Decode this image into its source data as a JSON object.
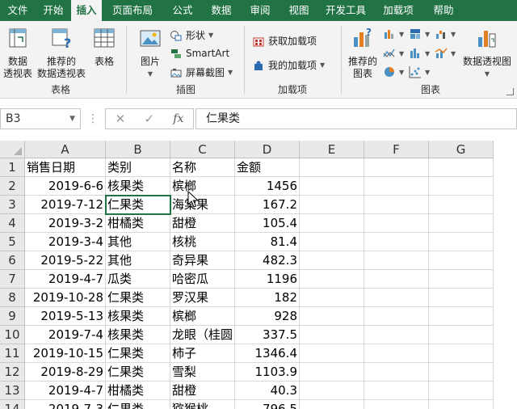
{
  "ribbon_tabs": [
    "文件",
    "开始",
    "插入",
    "页面布局",
    "公式",
    "数据",
    "审阅",
    "视图",
    "开发工具",
    "加载项",
    "帮助"
  ],
  "active_tab": "插入",
  "ribbon": {
    "tables": {
      "label": "表格",
      "pivot": "数据\n透视表",
      "recommended_pivot": "推荐的\n数据透视表",
      "table": "表格"
    },
    "illustrations": {
      "label": "插图",
      "pictures": "图片",
      "shapes": "形状",
      "smartart": "SmartArt",
      "screenshot": "屏幕截图"
    },
    "addins": {
      "label": "加载项",
      "get_addins": "获取加载项",
      "my_addins": "我的加载项"
    },
    "charts": {
      "label": "图表",
      "recommended_charts": "推荐的\n图表",
      "pivot_chart": "数据透视图"
    }
  },
  "formula_bar": {
    "name_box": "B3",
    "fx": "fx",
    "value": "仁果类"
  },
  "columns": [
    "A",
    "B",
    "C",
    "D",
    "E",
    "F",
    "G"
  ],
  "rows": [
    {
      "n": "1",
      "a": "销售日期",
      "b": "类别",
      "c": "名称",
      "d": "金额"
    },
    {
      "n": "2",
      "a": "2019-6-6",
      "b": "核果类",
      "c": "槟榔",
      "d": "1456"
    },
    {
      "n": "3",
      "a": "2019-7-12",
      "b": "仁果类",
      "c": "海棠果",
      "d": "167.2"
    },
    {
      "n": "4",
      "a": "2019-3-2",
      "b": "柑橘类",
      "c": "甜橙",
      "d": "105.4"
    },
    {
      "n": "5",
      "a": "2019-3-4",
      "b": "其他",
      "c": "核桃",
      "d": "81.4"
    },
    {
      "n": "6",
      "a": "2019-5-22",
      "b": "其他",
      "c": "奇异果",
      "d": "482.3"
    },
    {
      "n": "7",
      "a": "2019-4-7",
      "b": "瓜类",
      "c": "哈密瓜",
      "d": "1196"
    },
    {
      "n": "8",
      "a": "2019-10-28",
      "b": "仁果类",
      "c": "罗汉果",
      "d": "182"
    },
    {
      "n": "9",
      "a": "2019-5-13",
      "b": "核果类",
      "c": "槟榔",
      "d": "928"
    },
    {
      "n": "10",
      "a": "2019-7-4",
      "b": "核果类",
      "c": "龙眼（桂圆",
      "d": "337.5"
    },
    {
      "n": "11",
      "a": "2019-10-15",
      "b": "仁果类",
      "c": "柿子",
      "d": "1346.4"
    },
    {
      "n": "12",
      "a": "2019-8-29",
      "b": "仁果类",
      "c": "雪梨",
      "d": "1103.9"
    },
    {
      "n": "13",
      "a": "2019-4-7",
      "b": "柑橘类",
      "c": "甜橙",
      "d": "40.3"
    },
    {
      "n": "14",
      "a": "2019-7-3",
      "b": "仁果类",
      "c": "猕猴桃",
      "d": "796.5"
    }
  ],
  "colors": {
    "accent": "#217346",
    "ribbon_bg": "#f3f3f3",
    "header_bg": "#e9e9e9"
  }
}
